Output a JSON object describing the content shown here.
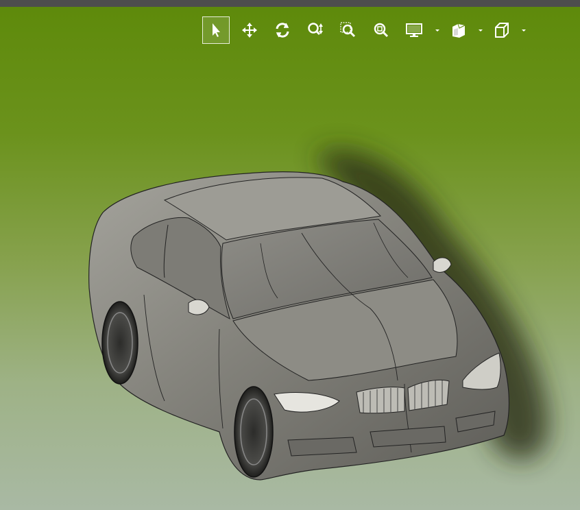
{
  "window": {
    "title": ""
  },
  "toolbar": {
    "tools": [
      {
        "name": "select-tool",
        "icon": "cursor-arrow-icon",
        "active": true
      },
      {
        "name": "pan-tool",
        "icon": "move-arrows-icon",
        "active": false
      },
      {
        "name": "rotate-tool",
        "icon": "rotate-icon",
        "active": false
      },
      {
        "name": "zoom-tool",
        "icon": "zoom-updown-icon",
        "active": false
      },
      {
        "name": "zoom-window-tool",
        "icon": "zoom-window-icon",
        "active": false
      },
      {
        "name": "zoom-fit-tool",
        "icon": "zoom-fit-icon",
        "active": false
      },
      {
        "name": "display-mode-dropdown",
        "icon": "monitor-icon",
        "has_dropdown": true
      },
      {
        "name": "view-style-dropdown",
        "icon": "view-style-icon",
        "has_dropdown": true
      },
      {
        "name": "standard-views-dropdown",
        "icon": "cube-icon",
        "has_dropdown": true
      }
    ]
  },
  "viewport": {
    "background_top": "#5e8a0b",
    "background_bottom": "#a9b9a4",
    "model": {
      "type": "car-3d-model",
      "shading": "grey-metallic-with-edges"
    }
  },
  "colors": {
    "accent_white": "#ffffff",
    "toolbar_bar": "#4d4d4d"
  }
}
